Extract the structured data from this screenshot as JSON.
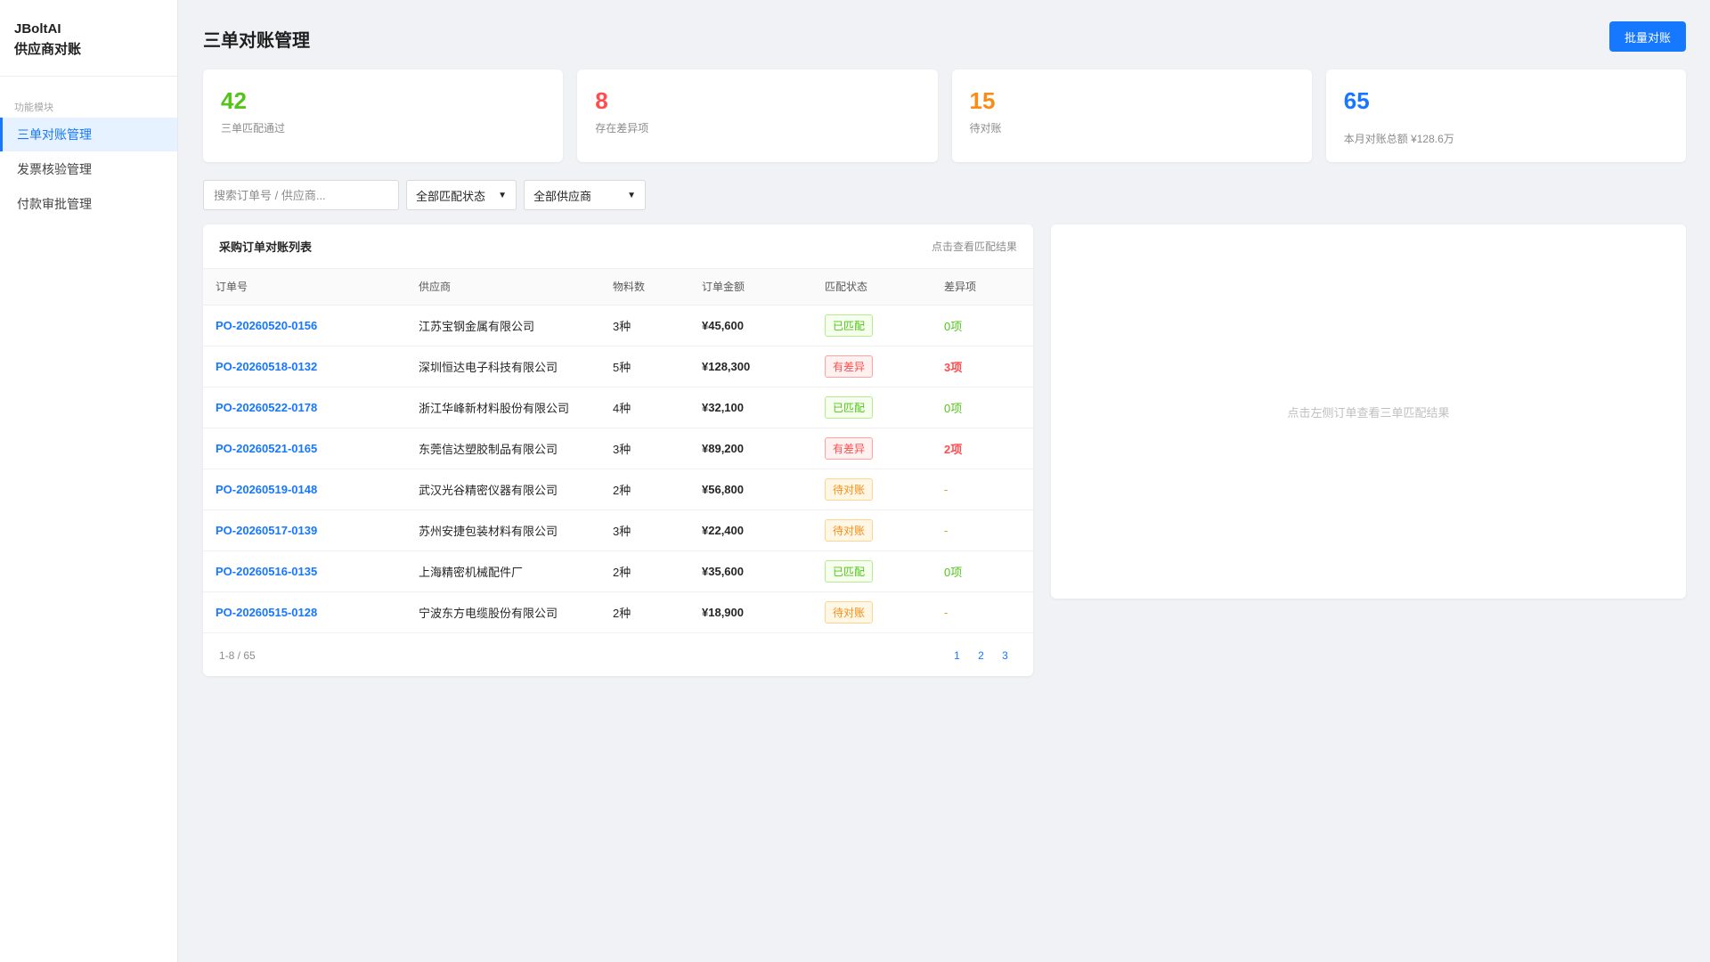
{
  "sidebar": {
    "brand_line1": "JBoltAI",
    "brand_line2": "供应商对账",
    "group_label": "功能模块",
    "items": [
      {
        "label": "三单对账管理",
        "active": true
      },
      {
        "label": "发票核验管理",
        "active": false
      },
      {
        "label": "付款审批管理",
        "active": false
      }
    ]
  },
  "header": {
    "title": "三单对账管理",
    "batch_button": "批量对账"
  },
  "stats": [
    {
      "value": "42",
      "label": "三单匹配通过",
      "color": "#52c41a"
    },
    {
      "value": "8",
      "label": "存在差异项",
      "color": "#ff4d4f"
    },
    {
      "value": "15",
      "label": "待对账",
      "color": "#fa8c16"
    },
    {
      "value": "65",
      "label": "本月对账总额 ¥128.6万",
      "color": "#1677ff"
    }
  ],
  "filters": {
    "search_placeholder": "搜索订单号 / 供应商...",
    "status_select": "全部匹配状态",
    "supplier_select": "全部供应商"
  },
  "table": {
    "title": "采购订单对账列表",
    "hint": "点击查看匹配结果",
    "columns": [
      "订单号",
      "供应商",
      "物料数",
      "订单金额",
      "匹配状态",
      "差异项"
    ],
    "rows": [
      {
        "po": "PO-20260520-0156",
        "supplier": "江苏宝钢金属有限公司",
        "items": "3种",
        "amount": "¥45,600",
        "status": "已匹配",
        "status_type": "ok",
        "diff": "0项",
        "diff_type": "ok"
      },
      {
        "po": "PO-20260518-0132",
        "supplier": "深圳恒达电子科技有限公司",
        "items": "5种",
        "amount": "¥128,300",
        "status": "有差异",
        "status_type": "diff",
        "diff": "3项",
        "diff_type": "bad"
      },
      {
        "po": "PO-20260522-0178",
        "supplier": "浙江华峰新材料股份有限公司",
        "items": "4种",
        "amount": "¥32,100",
        "status": "已匹配",
        "status_type": "ok",
        "diff": "0项",
        "diff_type": "ok"
      },
      {
        "po": "PO-20260521-0165",
        "supplier": "东莞信达塑胶制品有限公司",
        "items": "3种",
        "amount": "¥89,200",
        "status": "有差异",
        "status_type": "diff",
        "diff": "2项",
        "diff_type": "bad"
      },
      {
        "po": "PO-20260519-0148",
        "supplier": "武汉光谷精密仪器有限公司",
        "items": "2种",
        "amount": "¥56,800",
        "status": "待对账",
        "status_type": "pending",
        "diff": "-",
        "diff_type": "none"
      },
      {
        "po": "PO-20260517-0139",
        "supplier": "苏州安捷包装材料有限公司",
        "items": "3种",
        "amount": "¥22,400",
        "status": "待对账",
        "status_type": "pending",
        "diff": "-",
        "diff_type": "none"
      },
      {
        "po": "PO-20260516-0135",
        "supplier": "上海精密机械配件厂",
        "items": "2种",
        "amount": "¥35,600",
        "status": "已匹配",
        "status_type": "ok",
        "diff": "0项",
        "diff_type": "ok"
      },
      {
        "po": "PO-20260515-0128",
        "supplier": "宁波东方电缆股份有限公司",
        "items": "2种",
        "amount": "¥18,900",
        "status": "待对账",
        "status_type": "pending",
        "diff": "-",
        "diff_type": "none"
      }
    ],
    "range": "1-8 / 65",
    "pages": [
      "1",
      "2",
      "3"
    ]
  },
  "detail": {
    "empty_text": "点击左侧订单查看三单匹配结果"
  }
}
